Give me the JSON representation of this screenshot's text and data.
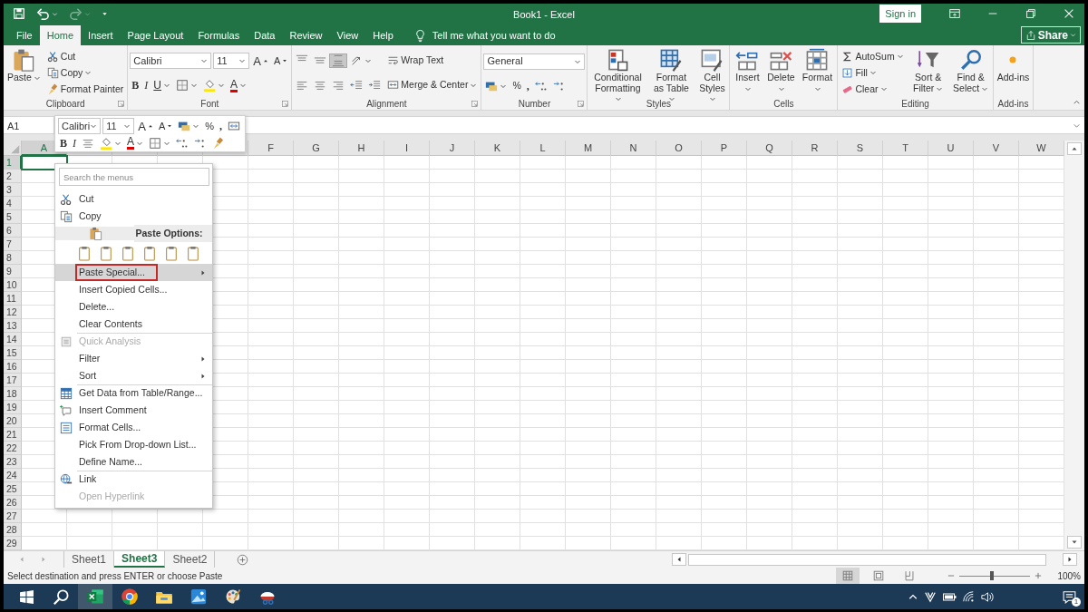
{
  "title_bar": {
    "title": "Book1 - Excel",
    "sign_in": "Sign in"
  },
  "menu_tabs": [
    {
      "label": "File",
      "selected": false
    },
    {
      "label": "Home",
      "selected": true
    },
    {
      "label": "Insert",
      "selected": false
    },
    {
      "label": "Page Layout",
      "selected": false
    },
    {
      "label": "Formulas",
      "selected": false
    },
    {
      "label": "Data",
      "selected": false
    },
    {
      "label": "Review",
      "selected": false
    },
    {
      "label": "View",
      "selected": false
    },
    {
      "label": "Help",
      "selected": false
    }
  ],
  "tell_me": {
    "placeholder": "Tell me what you want to do"
  },
  "share": "Share",
  "ribbon": [
    {
      "label": "Clipboard",
      "launcher": true,
      "columns": [
        [
          [
            {
              "kind": "large",
              "label": "Paste",
              "dropdown": true
            }
          ]
        ],
        [
          [
            {
              "kind": "small",
              "label": "Cut",
              "dropdown": false
            }
          ],
          [
            {
              "kind": "small",
              "label": "Copy",
              "dropdown": true
            }
          ],
          [
            {
              "kind": "small",
              "label": "Format Painter",
              "dropdown": false
            }
          ]
        ]
      ]
    },
    {
      "label": "Font",
      "launcher": true,
      "columns": [
        [
          [
            {
              "kind": "combo",
              "value": "Calibri"
            },
            {
              "kind": "combo",
              "value": "11"
            },
            {
              "kind": "text",
              "label": "A",
              "dropdown": false
            },
            {
              "kind": "text",
              "label": "A",
              "dropdown": false
            }
          ],
          [
            {
              "kind": "text",
              "label": "B",
              "dropdown": false
            },
            {
              "kind": "text",
              "label": "I",
              "dropdown": false
            },
            {
              "kind": "text",
              "label": "U",
              "dropdown": true
            },
            {
              "kind": "icon",
              "dropdown": true
            },
            {
              "kind": "icon",
              "dropdown": true
            },
            {
              "kind": "text",
              "label": "A",
              "dropdown": true
            }
          ]
        ]
      ]
    },
    {
      "label": "Alignment",
      "launcher": true,
      "columns": [
        [
          [
            {
              "kind": "icon",
              "dropdown": false,
              "selected": false
            },
            {
              "kind": "icon",
              "dropdown": false,
              "selected": false
            },
            {
              "kind": "icon",
              "dropdown": false,
              "selected": true
            },
            {
              "kind": "icon",
              "dropdown": true
            }
          ],
          [
            {
              "kind": "icon",
              "dropdown": false,
              "selected": false
            },
            {
              "kind": "icon",
              "dropdown": false,
              "selected": false
            },
            {
              "kind": "icon",
              "dropdown": false,
              "selected": false
            },
            {
              "kind": "icon",
              "dropdown": false
            },
            {
              "kind": "icon",
              "dropdown": false
            }
          ]
        ],
        [
          [
            {
              "kind": "small",
              "label": "Wrap Text",
              "dropdown": false
            }
          ],
          [
            {
              "kind": "small",
              "label": "Merge & Center",
              "dropdown": true
            }
          ]
        ]
      ]
    },
    {
      "label": "Number",
      "launcher": true,
      "columns": [
        [
          [
            {
              "kind": "combo",
              "value": "General"
            }
          ],
          [
            {
              "kind": "icon",
              "dropdown": true
            },
            {
              "kind": "text",
              "label": "%",
              "dropdown": false
            },
            {
              "kind": "text",
              "label": ",",
              "dropdown": false
            },
            {
              "kind": "icon",
              "dropdown": false
            },
            {
              "kind": "icon",
              "dropdown": false
            }
          ]
        ]
      ]
    },
    {
      "label": "Styles",
      "launcher": false,
      "columns": [
        [
          [
            {
              "kind": "large",
              "label": "Conditional Formatting",
              "dropdown": true
            }
          ]
        ],
        [
          [
            {
              "kind": "large",
              "label": "Format as Table",
              "dropdown": true
            }
          ]
        ],
        [
          [
            {
              "kind": "large",
              "label": "Cell Styles",
              "dropdown": true
            }
          ]
        ]
      ]
    },
    {
      "label": "Cells",
      "launcher": false,
      "columns": [
        [
          [
            {
              "kind": "large",
              "label": "Insert",
              "dropdown": true
            }
          ]
        ],
        [
          [
            {
              "kind": "large",
              "label": "Delete",
              "dropdown": true
            }
          ]
        ],
        [
          [
            {
              "kind": "large",
              "label": "Format",
              "dropdown": true
            }
          ]
        ]
      ]
    },
    {
      "label": "Editing",
      "launcher": false,
      "columns": [
        [
          [
            {
              "kind": "small",
              "label": "AutoSum",
              "dropdown": true
            }
          ],
          [
            {
              "kind": "small",
              "label": "Fill",
              "dropdown": true
            }
          ],
          [
            {
              "kind": "small",
              "label": "Clear",
              "dropdown": true
            }
          ]
        ],
        [
          [
            {
              "kind": "large",
              "label": "Sort & Filter",
              "dropdown": true
            }
          ]
        ],
        [
          [
            {
              "kind": "large",
              "label": "Find & Select",
              "dropdown": true
            }
          ]
        ]
      ]
    },
    {
      "label": "Add-ins",
      "launcher": false,
      "columns": [
        [
          [
            {
              "kind": "large",
              "label": "Add-ins",
              "dropdown": false
            }
          ]
        ]
      ]
    }
  ],
  "name_box": "A1",
  "mini_toolbar": [
    [
      {
        "kind": "combo",
        "value": "Calibri"
      },
      {
        "kind": "combo",
        "value": "11"
      },
      {
        "kind": "text",
        "label": "A",
        "dropdown": false
      },
      {
        "kind": "text",
        "label": "A",
        "dropdown": false
      },
      {
        "kind": "icon",
        "dropdown": true
      },
      {
        "kind": "text",
        "label": "%",
        "dropdown": false
      },
      {
        "kind": "text",
        "label": ",",
        "dropdown": false
      },
      {
        "kind": "icon",
        "dropdown": false
      }
    ],
    [
      {
        "kind": "text",
        "label": "B",
        "dropdown": false
      },
      {
        "kind": "text",
        "label": "I",
        "dropdown": false
      },
      {
        "kind": "icon",
        "dropdown": false
      },
      {
        "kind": "icon",
        "dropdown": true
      },
      {
        "kind": "text",
        "label": "A",
        "dropdown": true
      },
      {
        "kind": "icon",
        "dropdown": true
      },
      {
        "kind": "icon",
        "dropdown": false
      },
      {
        "kind": "icon",
        "dropdown": false
      },
      {
        "kind": "icon",
        "dropdown": false
      }
    ]
  ],
  "columns": [
    {
      "label": "A",
      "selected": true
    },
    {
      "selected": false
    },
    {
      "selected": false
    },
    {
      "selected": false
    },
    {
      "selected": false
    },
    {
      "label": "F",
      "selected": false
    },
    {
      "label": "G",
      "selected": false
    },
    {
      "label": "H",
      "selected": false
    },
    {
      "label": "I",
      "selected": false
    },
    {
      "label": "J",
      "selected": false
    },
    {
      "label": "K",
      "selected": false
    },
    {
      "label": "L",
      "selected": false
    },
    {
      "label": "M",
      "selected": false
    },
    {
      "label": "N",
      "selected": false
    },
    {
      "label": "O",
      "selected": false
    },
    {
      "label": "P",
      "selected": false
    },
    {
      "label": "Q",
      "selected": false
    },
    {
      "label": "R",
      "selected": false
    },
    {
      "label": "S",
      "selected": false
    },
    {
      "label": "T",
      "selected": false
    },
    {
      "label": "U",
      "selected": false
    },
    {
      "label": "V",
      "selected": false
    },
    {
      "label": "W",
      "selected": false
    }
  ],
  "rows": [
    {
      "label": "1",
      "selected": true
    },
    {
      "label": "2",
      "selected": false
    },
    {
      "label": "3",
      "selected": false
    },
    {
      "label": "4",
      "selected": false
    },
    {
      "label": "5",
      "selected": false
    },
    {
      "label": "6",
      "selected": false
    },
    {
      "label": "7",
      "selected": false
    },
    {
      "label": "8",
      "selected": false
    },
    {
      "label": "9",
      "selected": false
    },
    {
      "label": "10",
      "selected": false
    },
    {
      "label": "11",
      "selected": false
    },
    {
      "label": "12",
      "selected": false
    },
    {
      "label": "13",
      "selected": false
    },
    {
      "label": "14",
      "selected": false
    },
    {
      "label": "15",
      "selected": false
    },
    {
      "label": "16",
      "selected": false
    },
    {
      "label": "17",
      "selected": false
    },
    {
      "label": "18",
      "selected": false
    },
    {
      "label": "19",
      "selected": false
    },
    {
      "label": "20",
      "selected": false
    },
    {
      "label": "21",
      "selected": false
    },
    {
      "label": "22",
      "selected": false
    },
    {
      "label": "23",
      "selected": false
    },
    {
      "label": "24",
      "selected": false
    },
    {
      "label": "25",
      "selected": false
    },
    {
      "label": "26",
      "selected": false
    },
    {
      "label": "27",
      "selected": false
    },
    {
      "label": "28",
      "selected": false
    },
    {
      "label": "29",
      "selected": false
    }
  ],
  "context_menu": {
    "search": {
      "placeholder": "Search the menus"
    },
    "items": [
      {
        "kind": "item",
        "label": "Cut",
        "disabled": false,
        "submenu": false,
        "selected": false,
        "divider_above": false
      },
      {
        "kind": "item",
        "label": "Copy",
        "disabled": false,
        "submenu": false,
        "selected": false,
        "divider_above": false
      },
      {
        "kind": "header",
        "label": "Paste Options:"
      },
      {
        "kind": "paste_icons"
      },
      {
        "kind": "item",
        "label": "Paste Special...",
        "disabled": false,
        "submenu": true,
        "selected": true,
        "divider_above": false
      },
      {
        "kind": "item",
        "label": "Insert Copied Cells...",
        "disabled": false,
        "submenu": false,
        "selected": false,
        "divider_above": false
      },
      {
        "kind": "item",
        "label": "Delete...",
        "disabled": false,
        "submenu": false,
        "selected": false,
        "divider_above": false
      },
      {
        "kind": "item",
        "label": "Clear Contents",
        "disabled": false,
        "submenu": false,
        "selected": false,
        "divider_above": false
      },
      {
        "kind": "item",
        "label": "Quick Analysis",
        "disabled": true,
        "submenu": false,
        "selected": false,
        "divider_above": true
      },
      {
        "kind": "item",
        "label": "Filter",
        "disabled": false,
        "submenu": true,
        "selected": false,
        "divider_above": false
      },
      {
        "kind": "item",
        "label": "Sort",
        "disabled": false,
        "submenu": true,
        "selected": false,
        "divider_above": false
      },
      {
        "kind": "item",
        "label": "Get Data from Table/Range...",
        "disabled": false,
        "submenu": false,
        "selected": false,
        "divider_above": true
      },
      {
        "kind": "item",
        "label": "Insert Comment",
        "disabled": false,
        "submenu": false,
        "selected": false,
        "divider_above": false
      },
      {
        "kind": "item",
        "label": "Format Cells...",
        "disabled": false,
        "submenu": false,
        "selected": false,
        "divider_above": false
      },
      {
        "kind": "item",
        "label": "Pick From Drop-down List...",
        "disabled": false,
        "submenu": false,
        "selected": false,
        "divider_above": false
      },
      {
        "kind": "item",
        "label": "Define Name...",
        "disabled": false,
        "submenu": false,
        "selected": false,
        "divider_above": false
      },
      {
        "kind": "item",
        "label": "Link",
        "disabled": false,
        "submenu": false,
        "selected": false,
        "divider_above": true
      },
      {
        "kind": "item",
        "label": "Open Hyperlink",
        "disabled": true,
        "submenu": false,
        "selected": false,
        "divider_above": false
      }
    ]
  },
  "sheet_tabs": [
    {
      "label": "Sheet1",
      "selected": false
    },
    {
      "label": "Sheet3",
      "selected": true
    },
    {
      "label": "Sheet2",
      "selected": false
    }
  ],
  "status_bar": {
    "message": "Select destination and press ENTER or choose Paste",
    "views": [
      {
        "selected": true
      },
      {
        "selected": false
      },
      {
        "selected": false
      }
    ],
    "zoom": {
      "level": 0.45,
      "reading": "100%"
    }
  },
  "taskbar": {
    "apps": [
      {
        "selected": true
      },
      {
        "selected": false
      },
      {
        "selected": false
      },
      {
        "selected": false
      },
      {
        "selected": false
      },
      {
        "selected": false
      }
    ],
    "notifications": "1"
  }
}
